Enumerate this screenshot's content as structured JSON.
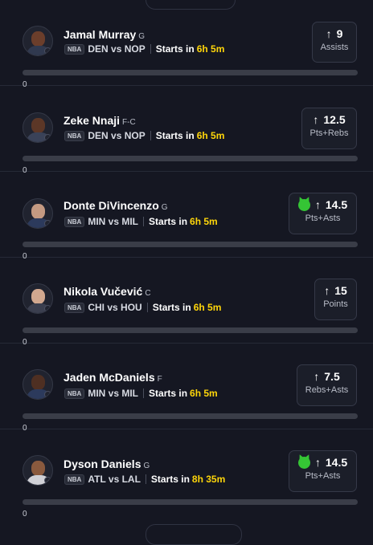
{
  "players": [
    {
      "name": "Jamal Murray",
      "position": "G",
      "league": "NBA",
      "matchup": "DEN vs NOP",
      "starts_label": "Starts in",
      "time": "6h 5m",
      "line": "9",
      "stat": "Assists",
      "demon": false,
      "progress_value": "0"
    },
    {
      "name": "Zeke Nnaji",
      "position": "F-C",
      "league": "NBA",
      "matchup": "DEN vs NOP",
      "starts_label": "Starts in",
      "time": "6h 5m",
      "line": "12.5",
      "stat": "Pts+Rebs",
      "demon": false,
      "progress_value": "0"
    },
    {
      "name": "Donte DiVincenzo",
      "position": "G",
      "league": "NBA",
      "matchup": "MIN vs MIL",
      "starts_label": "Starts in",
      "time": "6h 5m",
      "line": "14.5",
      "stat": "Pts+Asts",
      "demon": true,
      "progress_value": "0"
    },
    {
      "name": "Nikola Vučević",
      "position": "C",
      "league": "NBA",
      "matchup": "CHI vs HOU",
      "starts_label": "Starts in",
      "time": "6h 5m",
      "line": "15",
      "stat": "Points",
      "demon": false,
      "progress_value": "0"
    },
    {
      "name": "Jaden McDaniels",
      "position": "F",
      "league": "NBA",
      "matchup": "MIN vs MIL",
      "starts_label": "Starts in",
      "time": "6h 5m",
      "line": "7.5",
      "stat": "Rebs+Asts",
      "demon": false,
      "progress_value": "0"
    },
    {
      "name": "Dyson Daniels",
      "position": "G",
      "league": "NBA",
      "matchup": "ATL vs LAL",
      "starts_label": "Starts in",
      "time": "8h 35m",
      "line": "14.5",
      "stat": "Pts+Asts",
      "demon": true,
      "progress_value": "0"
    }
  ],
  "icons": {
    "arrow": "arrow-up-icon",
    "demon": "demon-icon",
    "avatar": "player-avatar"
  },
  "colors": {
    "background": "#151722",
    "time_accent": "#ffd60a",
    "demon": "#35c535",
    "progress_track": "#3a3d48"
  }
}
